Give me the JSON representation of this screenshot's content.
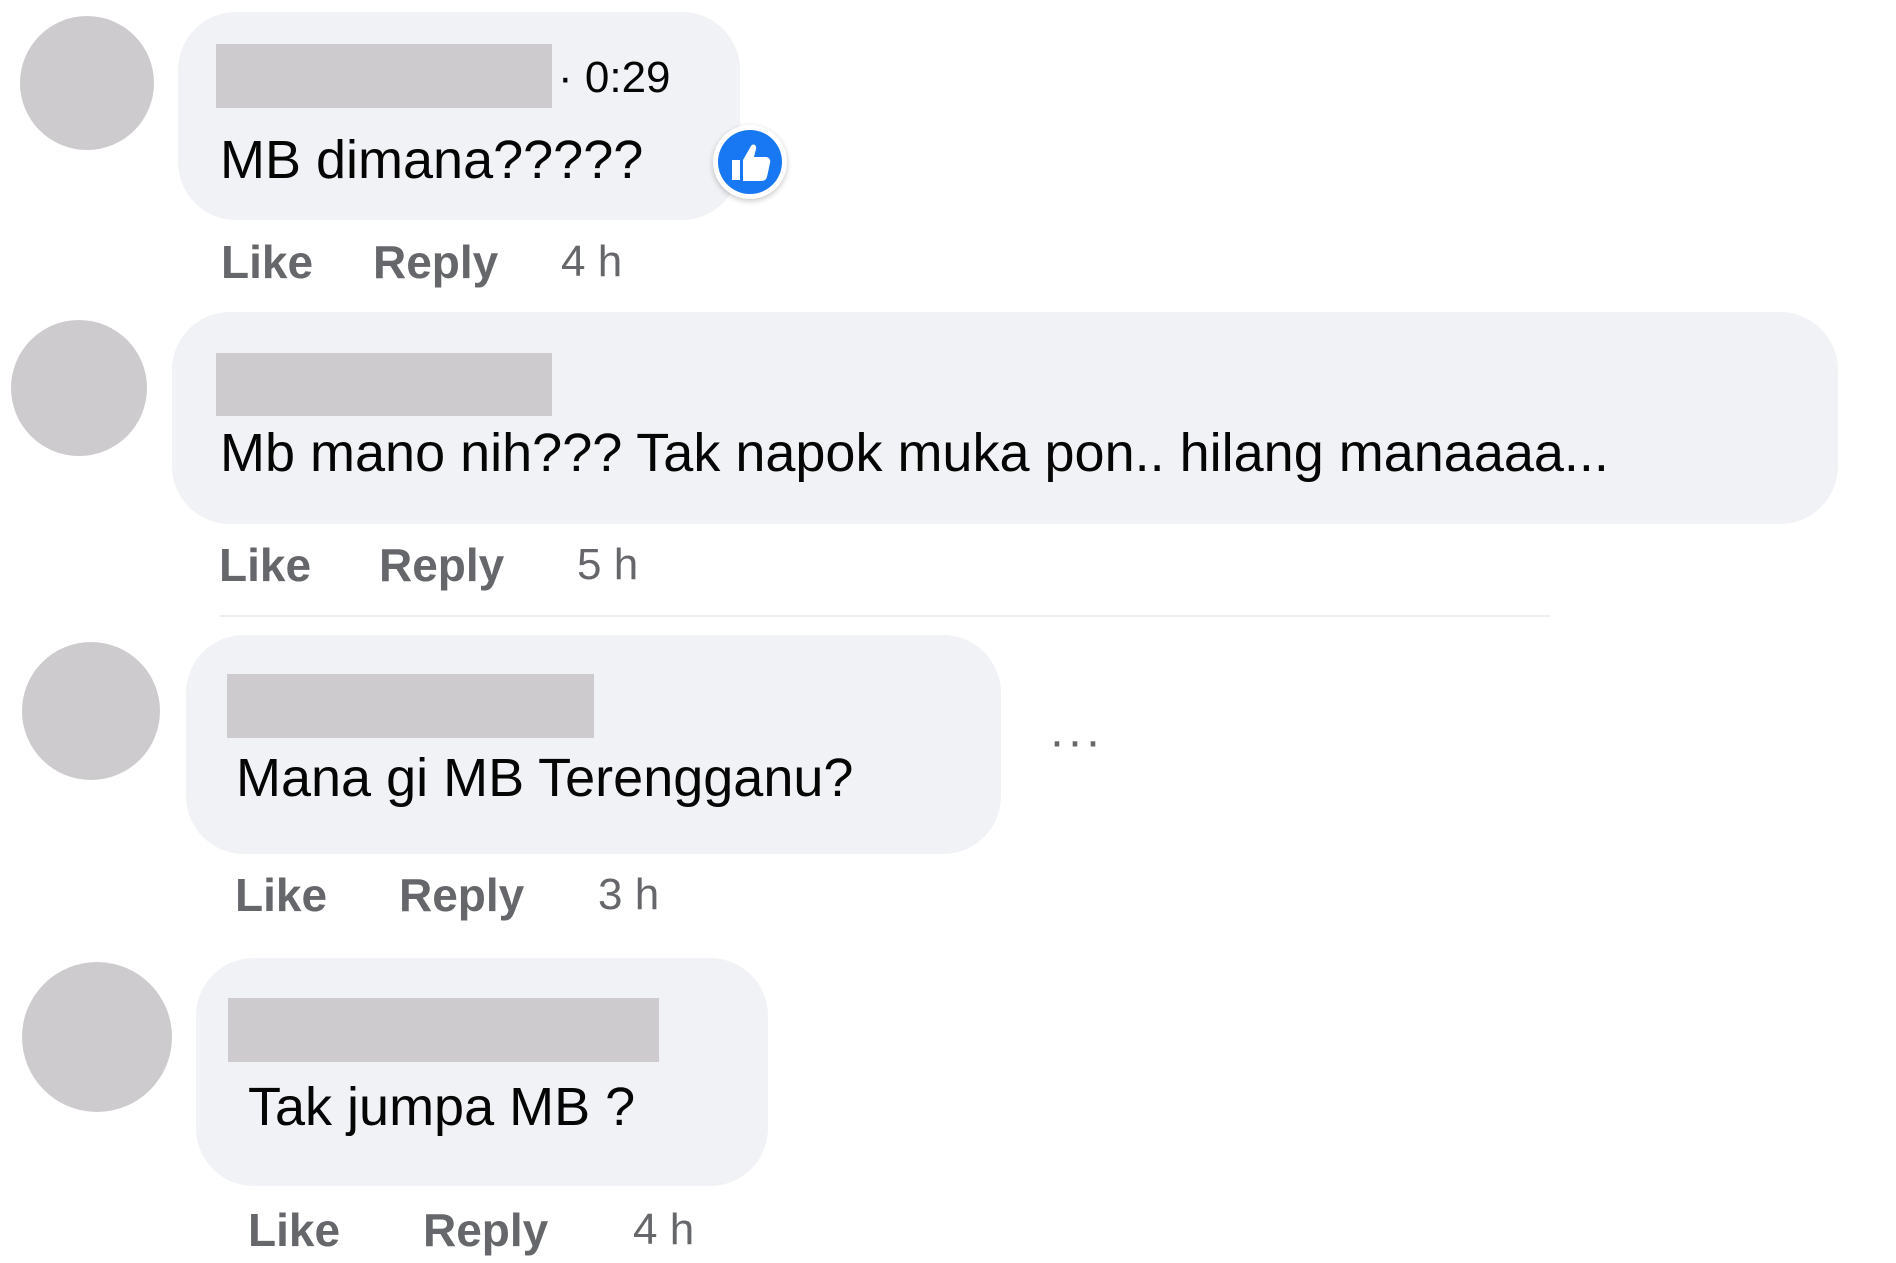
{
  "colors": {
    "bubble": "#f0f2f5",
    "redaction": "#cdcbcd",
    "action_text": "#65676b",
    "like_badge": "#1877f2"
  },
  "comments": [
    {
      "timestamp": "· 0:29",
      "text": "MB dimana?????",
      "reaction_icon": "thumbs-up-icon",
      "like_label": "Like",
      "reply_label": "Reply",
      "age": "4 h"
    },
    {
      "text": "Mb mano nih??? Tak napok muka pon.. hilang manaaaa...",
      "like_label": "Like",
      "reply_label": "Reply",
      "age": "5 h"
    },
    {
      "text": "Mana gi MB Terengganu?",
      "more_label": "···",
      "like_label": "Like",
      "reply_label": "Reply",
      "age": "3 h"
    },
    {
      "text": "Tak jumpa MB ?",
      "like_label": "Like",
      "reply_label": "Reply",
      "age": "4 h"
    }
  ]
}
